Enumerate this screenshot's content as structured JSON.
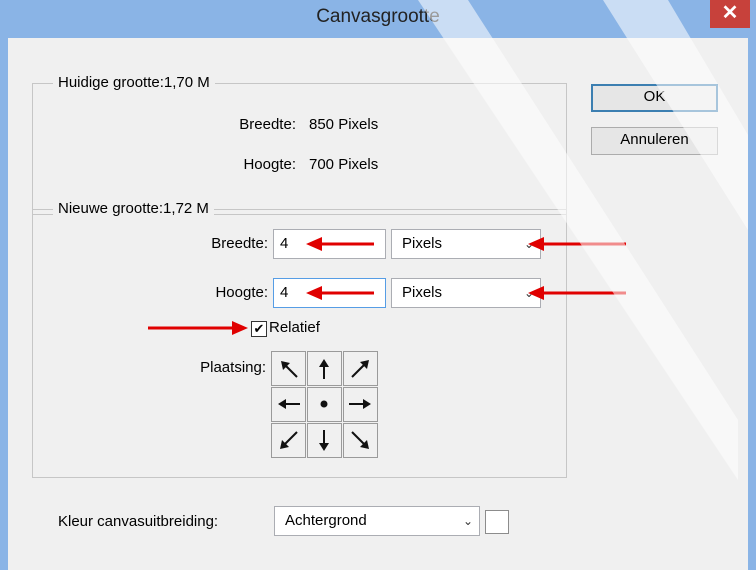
{
  "dialog": {
    "title": "Canvasgrootte",
    "close_glyph": "✕"
  },
  "current_size": {
    "legend": "Huidige grootte:1,70 M",
    "width_label": "Breedte:",
    "width_value": "850 Pixels",
    "height_label": "Hoogte:",
    "height_value": "700 Pixels"
  },
  "new_size": {
    "legend": "Nieuwe grootte:1,72 M",
    "width_label": "Breedte:",
    "width_value": "4",
    "width_unit": "Pixels",
    "height_label": "Hoogte:",
    "height_value": "4",
    "height_unit": "Pixels",
    "relative_label": "Relatief",
    "relative_checked": "✔",
    "placement_label": "Plaatsing:"
  },
  "anchor_grid": [
    "nw-arrow",
    "n-arrow",
    "ne-arrow",
    "w-arrow",
    "center-dot",
    "e-arrow",
    "sw-arrow",
    "s-arrow",
    "se-arrow"
  ],
  "buttons": {
    "ok": "OK",
    "cancel": "Annuleren"
  },
  "extension": {
    "label": "Kleur canvasuitbreiding:",
    "value": "Achtergrond"
  },
  "colors": {
    "annotation_arrow": "#e00000",
    "title_bar": "#8ab4e6",
    "close_button": "#c7413b"
  }
}
